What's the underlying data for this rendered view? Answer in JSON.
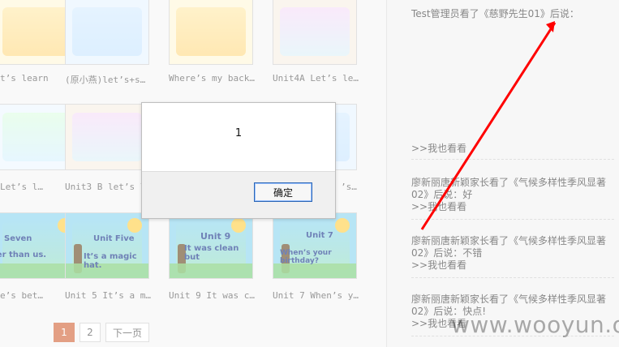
{
  "grid": {
    "row1": [
      {
        "caption": "t’s learn"
      },
      {
        "caption": "(原小燕)let’s+s…"
      },
      {
        "caption": "Where’s my back…"
      },
      {
        "caption": "Unit4A Let’s le…"
      }
    ],
    "row2": [
      {
        "caption": "Let’s l…"
      },
      {
        "caption": "Unit3 B let’s l…"
      },
      {
        "caption": "’s…"
      }
    ],
    "row3": [
      {
        "caption": "e’s bet…",
        "thumb_text_1": "Seven",
        "thumb_text_2": "ter than us."
      },
      {
        "caption": "Unit 5 It’s a m…",
        "thumb_text_1": "Unit Five",
        "thumb_text_2": "It’s a magic hat."
      },
      {
        "caption": "Unit 9 It was c…",
        "thumb_text_1": "Unit 9",
        "thumb_text_2": "It was clean but"
      },
      {
        "caption": "Unit 7 When’s y…",
        "thumb_text_1": "Unit 7",
        "thumb_text_2": "When’s your birthday?"
      }
    ]
  },
  "pager": {
    "page1": "1",
    "page2": "2",
    "next": "下一页"
  },
  "feed": {
    "top": "Test管理员看了《慈野先生01》后说：",
    "see_label_1": ">>我也看看",
    "item_1_line_1": "廖新丽唐新颖家长看了《气候多样性季风显著",
    "item_1_line_2": "02》后说：好",
    "see_label_2": ">>我也看看",
    "item_2_line_1": "廖新丽唐新颖家长看了《气候多样性季风显著",
    "item_2_line_2": "02》后说：不错",
    "see_label_3": ">>我也看看",
    "item_3_line_1": "廖新丽唐新颖家长看了《气候多样性季风显著",
    "item_3_line_2": "02》后说：快点!",
    "see_label_4": ">>我也看看"
  },
  "dialog": {
    "message": "1",
    "ok_label": "确定"
  },
  "watermark": {
    "text": "www.wooyun.org"
  },
  "colors": {
    "pager_active": "#d46a3f",
    "dialog_button_border": "#2b66b5",
    "arrow_red": "#ff0000"
  }
}
